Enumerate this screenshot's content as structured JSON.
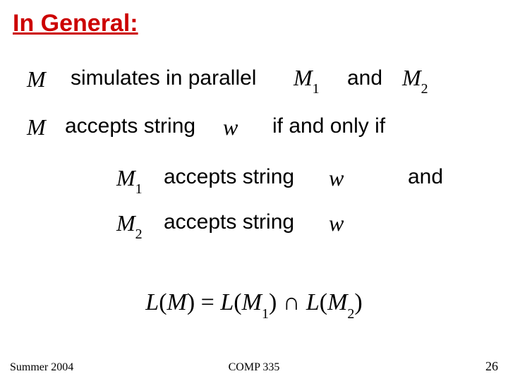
{
  "title": "In General:",
  "line1": {
    "t1": "simulates in parallel",
    "t2": "and"
  },
  "line2": {
    "t1": "accepts string",
    "t2": "if and only if"
  },
  "line3": {
    "t1": "accepts string",
    "t2": "and"
  },
  "line4": {
    "t1": "accepts string"
  },
  "sym": {
    "M": "M",
    "M1a": "M",
    "M1s": "1",
    "M2a": "M",
    "M2s": "2",
    "w": "w"
  },
  "equation": {
    "lhs_L": "L",
    "lhs_openp": "(",
    "lhs_M": "M",
    "lhs_closep": ")",
    "eq": " = ",
    "r1_L": "L",
    "r1_openp": "(",
    "r1_M": "M",
    "r1_sub": "1",
    "r1_closep": ")",
    "cap": " ∩ ",
    "r2_L": "L",
    "r2_openp": "(",
    "r2_M": "M",
    "r2_sub": "2",
    "r2_closep": ")"
  },
  "footer": {
    "left": "Summer 2004",
    "center": "COMP 335",
    "right": "26"
  }
}
